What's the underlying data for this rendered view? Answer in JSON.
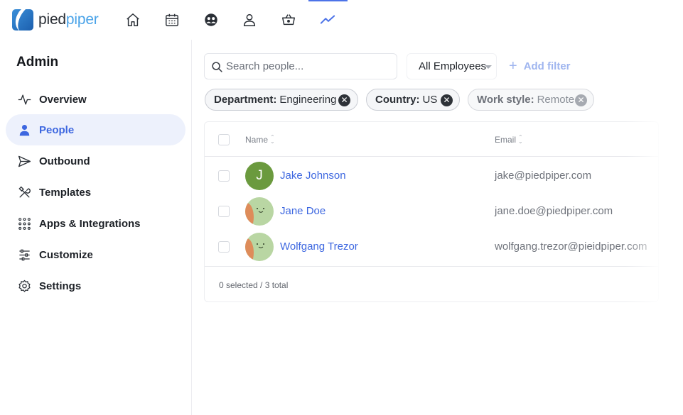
{
  "app": {
    "logo_part1": "pied",
    "logo_part2": "piper",
    "brand_color": "#4aa3e8",
    "accent_color": "#3d67e0"
  },
  "topnav": {
    "icons": [
      "home-icon",
      "calendar-icon",
      "team-icon",
      "user-icon",
      "basket-icon",
      "trending-icon"
    ],
    "active": "trending-icon"
  },
  "sidebar": {
    "title": "Admin",
    "items": [
      {
        "label": "Overview",
        "icon": "activity-icon"
      },
      {
        "label": "People",
        "icon": "person-icon",
        "active": true
      },
      {
        "label": "Outbound",
        "icon": "send-icon"
      },
      {
        "label": "Templates",
        "icon": "tools-icon"
      },
      {
        "label": "Apps & Integrations",
        "icon": "grid-dots-icon"
      },
      {
        "label": "Customize",
        "icon": "sliders-icon"
      },
      {
        "label": "Settings",
        "icon": "gear-icon"
      }
    ]
  },
  "toolbar": {
    "search_placeholder": "Search people...",
    "search_value": "",
    "employee_filter": "All Employees",
    "add_filter_label": "Add filter"
  },
  "filters": [
    {
      "key": "Department:",
      "value": "Engineering"
    },
    {
      "key": "Country:",
      "value": "US"
    },
    {
      "key": "Work style:",
      "value": "Remote",
      "faded": true
    }
  ],
  "table": {
    "columns": [
      "Name",
      "Email"
    ],
    "rows": [
      {
        "name": "Jake Johnson",
        "email": "jake@piedpiper.com",
        "avatar": "J"
      },
      {
        "name": "Jane Doe",
        "email": "jane.doe@piedpiper.com",
        "avatar": ""
      },
      {
        "name": "Wolfgang Trezor",
        "email": "wolfgang.trezor@pieidpiper.com",
        "avatar": ""
      }
    ],
    "footer": "0 selected / 3 total"
  }
}
